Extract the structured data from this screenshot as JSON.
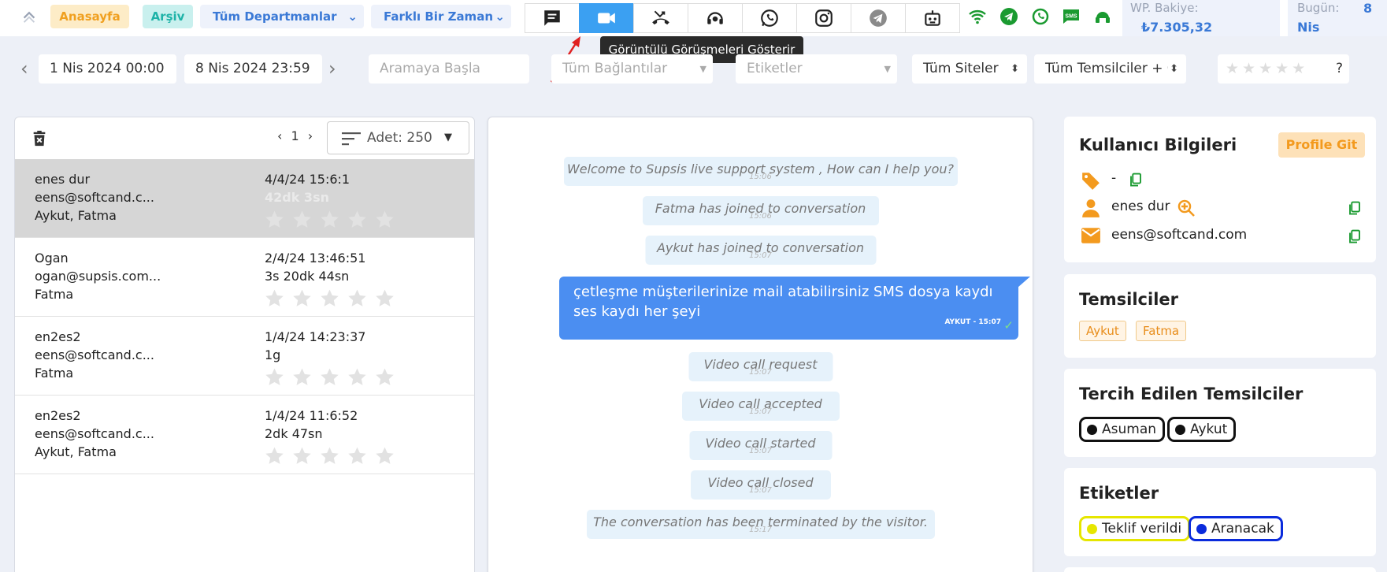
{
  "topbar": {
    "home_label": "Anasayfa",
    "archive_label": "Arşiv",
    "department_select": "Tüm Departmanlar",
    "time_select": "Farklı Bir Zaman",
    "channel_icons": [
      "chat-icon",
      "video-camera-icon",
      "missed-call-icon",
      "support-agent-icon",
      "whatsapp-icon",
      "instagram-icon",
      "telegram-icon",
      "bot-icon"
    ],
    "status_icons": [
      "wifi-icon",
      "telegram-icon",
      "whatsapp-icon",
      "sms-icon",
      "support-icon"
    ],
    "sms_text": "SMS",
    "balance_label": "WP. Bakiye:",
    "balance_value": "₺7.305,32",
    "today_label": "Bugün:",
    "today_count": "8",
    "today_month": "Nis"
  },
  "tooltip": "Görüntülü Görüşmeleri Gösterir",
  "filters": {
    "date_start": "1 Nis 2024 00:00",
    "date_end": "8 Nis 2024 23:59",
    "search_placeholder": "Aramaya Başla",
    "connections_placeholder": "Tüm Bağlantılar",
    "tags_placeholder": "Etiketler",
    "sites_select": "Tüm Siteler",
    "agents_select": "Tüm Temsilciler + Ç",
    "rating_question": "?"
  },
  "list": {
    "page": "1",
    "count_label": "Adet: 250",
    "rows": [
      {
        "name": "enes dur",
        "email": "eens@softcand.c...",
        "agents": "Aykut, Fatma",
        "date": "4/4/24 15:6:1",
        "duration": "42dk 3sn",
        "selected": true
      },
      {
        "name": "Ogan",
        "email": "ogan@supsis.com...",
        "agents": "Fatma",
        "date": "2/4/24 13:46:51",
        "duration": "3s 20dk 44sn",
        "selected": false
      },
      {
        "name": "en2es2",
        "email": "eens@softcand.c...",
        "agents": "Fatma",
        "date": "1/4/24 14:23:37",
        "duration": "1g",
        "selected": false
      },
      {
        "name": "en2es2",
        "email": "eens@softcand.c...",
        "agents": "Aykut, Fatma",
        "date": "1/4/24 11:6:52",
        "duration": "2dk 47sn",
        "selected": false
      }
    ]
  },
  "chat": {
    "welcome": {
      "text": "Welcome to Supsis live support system , How can I help you?",
      "time": "15:06"
    },
    "fatma_joined": {
      "text": "Fatma has joined to conversation",
      "time": "15:06"
    },
    "aykut_joined": {
      "text": "Aykut has joined to conversation",
      "time": "15:07"
    },
    "agent_message": {
      "text": "çetleşme müşterilerinize mail atabilirsiniz SMS dosya kaydı ses kaydı her şeyi",
      "meta": "AYKUT - 15:07"
    },
    "video_request": {
      "text": "Video call request",
      "time": "15:07"
    },
    "video_accepted": {
      "text": "Video call accepted",
      "time": "15:07"
    },
    "video_started": {
      "text": "Video call started",
      "time": "15:07"
    },
    "video_closed": {
      "text": "Video call closed",
      "time": "15:07"
    },
    "terminated": {
      "text": "The conversation has been terminated by the visitor.",
      "time": "15:17"
    }
  },
  "user_info": {
    "title": "Kullanıcı Bilgileri",
    "profile_button": "Profile Git",
    "tag_value": "-",
    "name": "enes dur",
    "email": "eens@softcand.com"
  },
  "agents": {
    "title": "Temsilciler",
    "items": [
      "Aykut",
      "Fatma"
    ]
  },
  "preferred_agents": {
    "title": "Tercih Edilen Temsilciler",
    "items": [
      "Asuman",
      "Aykut"
    ]
  },
  "labels": {
    "title": "Etiketler",
    "items": [
      {
        "name": "Teklif verildi",
        "color": "#e6e600"
      },
      {
        "name": "Aranacak",
        "color": "#0a2bdc"
      }
    ]
  },
  "colors": {
    "accent": "#3d8df0",
    "agent_bubble": "#4b8ef1",
    "orange": "#f39a1e",
    "active_tab": "#3ba0f2"
  }
}
